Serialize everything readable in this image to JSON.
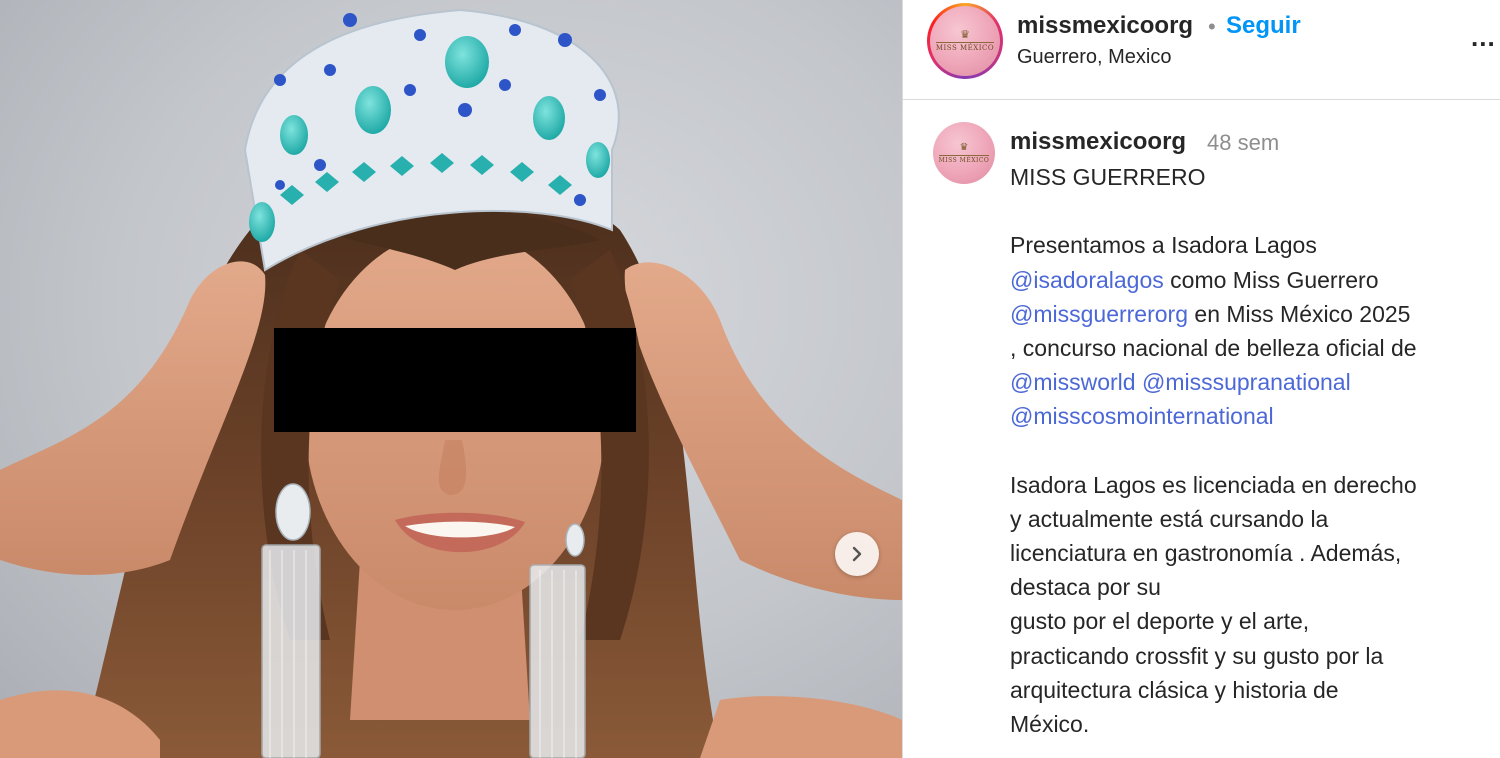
{
  "post": {
    "account": {
      "username": "missmexicoorg",
      "separator": "•",
      "follow_label": "Seguir",
      "location": "Guerrero, Mexico",
      "more_label": "...",
      "avatar_brand": "MISS MÉXICO",
      "avatar_icon": "crown-icon"
    },
    "media": {
      "next_icon": "chevron-right-icon"
    },
    "caption": {
      "username": "missmexicoorg",
      "time": "48 sem",
      "title": "MISS GUERRERO",
      "intro_1": "Presentamos a  Isadora Lagos",
      "mention_isadora": "@isadoralagos",
      "intro_2": " como Miss Guerrero",
      "mention_guerrero": "@missguerrerorg",
      "intro_3": "  en Miss México 2025",
      "intro_4": ", concurso nacional de belleza oficial de",
      "mention_world": "@missworld",
      "mention_supra": " @misssupranational",
      "mention_cosmo": "@misscosmointernational",
      "bio_lines": [
        "Isadora Lagos es licenciada en derecho",
        "y actualmente está cursando la",
        "licenciatura en gastronomía . Además,",
        "destaca por su",
        "gusto por el deporte y el arte,",
        "practicando crossfit  y su gusto por la",
        "arquitectura clásica y historia de",
        "México."
      ]
    },
    "colors": {
      "link": "#0095f6",
      "mention": "#4c68d7",
      "muted": "#8e8e8e",
      "text": "#262626"
    }
  }
}
